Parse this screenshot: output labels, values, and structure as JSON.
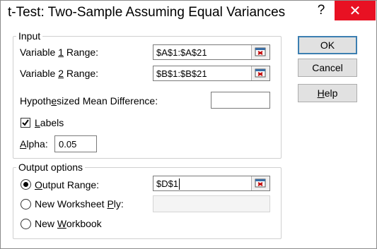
{
  "dialog": {
    "title": "t-Test: Two-Sample Assuming Equal Variances",
    "help_glyph": "?",
    "close_glyph": "✕"
  },
  "input_group": {
    "legend": "Input",
    "var1_label_pre": "Variable ",
    "var1_label_u": "1",
    "var1_label_post": " Range:",
    "var1_value": "$A$1:$A$21",
    "var2_label_pre": "Variable ",
    "var2_label_u": "2",
    "var2_label_post": " Range:",
    "var2_value": "$B$1:$B$21",
    "hyp_label_pre": "Hypoth",
    "hyp_label_u": "e",
    "hyp_label_post": "sized Mean Difference:",
    "hyp_value": "",
    "labels_u": "L",
    "labels_post": "abels",
    "labels_checked": true,
    "alpha_u": "A",
    "alpha_post": "lpha:",
    "alpha_value": "0.05"
  },
  "output_group": {
    "legend": "Output options",
    "output_range_u": "O",
    "output_range_post": "utput Range:",
    "output_range_value": "$D$1",
    "new_ply_pre": "New Worksheet ",
    "new_ply_u": "P",
    "new_ply_post": "ly:",
    "new_ply_value": "",
    "new_wb_pre": "New ",
    "new_wb_u": "W",
    "new_wb_post": "orkbook",
    "selected": "output_range"
  },
  "buttons": {
    "ok": "OK",
    "cancel": "Cancel",
    "help_u": "H",
    "help_post": "elp"
  },
  "colors": {
    "close_bg": "#e81123",
    "default_button_border": "#3c7fb1"
  }
}
